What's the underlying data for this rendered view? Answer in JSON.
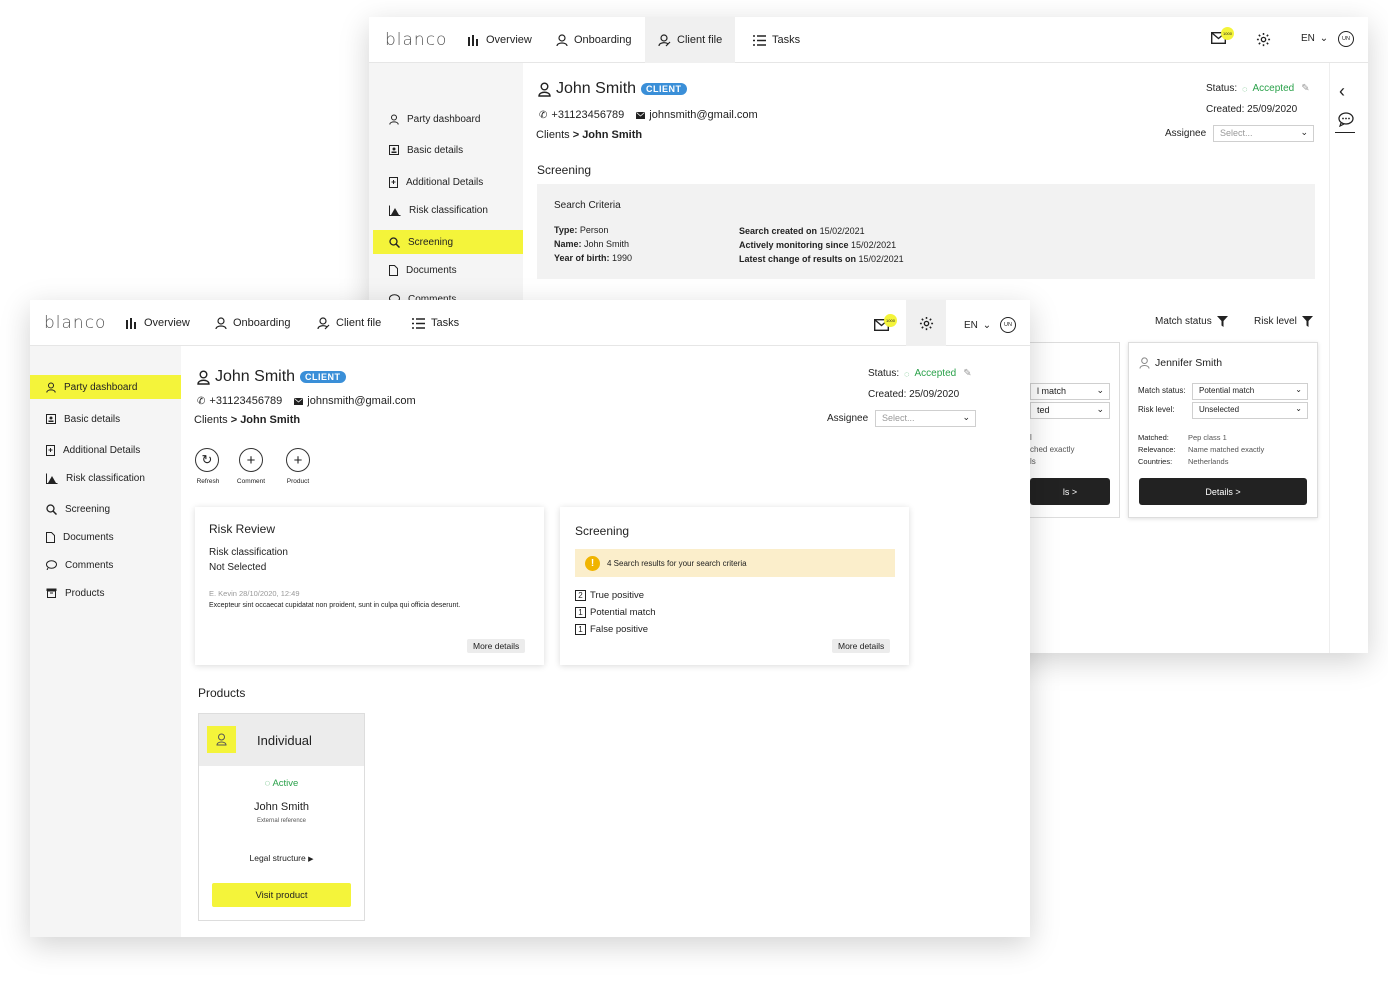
{
  "logo": "blanco",
  "nav": {
    "overview": "Overview",
    "onboarding": "Onboarding",
    "client_file": "Client file",
    "tasks": "Tasks",
    "mail_badge": "1000",
    "language": "EN",
    "avatar": "UN"
  },
  "sidebar": {
    "party_dashboard": "Party dashboard",
    "basic_details": "Basic details",
    "additional_details": "Additional Details",
    "risk_classification": "Risk classification",
    "screening": "Screening",
    "documents": "Documents",
    "comments": "Comments",
    "products": "Products"
  },
  "client": {
    "name": "John Smith",
    "tag": "CLIENT",
    "phone": "+31123456789",
    "email": "johnsmith@gmail.com",
    "breadcrumb_root": "Clients",
    "breadcrumb_sep": ">",
    "breadcrumb_current": "John Smith",
    "status_label": "Status:",
    "status_value": "Accepted",
    "created": "Created: 25/09/2020",
    "assignee_label": "Assignee",
    "assignee_placeholder": "Select..."
  },
  "back": {
    "section_title": "Screening",
    "criteria_title": "Search Criteria",
    "type_label": "Type:",
    "type_value": "Person",
    "name_label": "Name:",
    "name_value": "John Smith",
    "yob_label": "Year of birth:",
    "yob_value": "1990",
    "created_label": "Search created on",
    "created_value": "15/02/2021",
    "monitoring_label": "Actively monitoring since",
    "monitoring_value": "15/02/2021",
    "latest_label": "Latest change of results on",
    "latest_value": "15/02/2021",
    "match_status_filter": "Match status",
    "risk_level_filter": "Risk level",
    "partial_card": {
      "sel1": "l match",
      "sel2": "ted",
      "line1": "l",
      "line2": "ched exactly",
      "line3": "ls",
      "button": "ls >"
    },
    "result_card": {
      "name": "Jennifer Smith",
      "match_status_label": "Match status:",
      "match_status_value": "Potential match",
      "risk_level_label": "Risk level:",
      "risk_level_value": "Unselected",
      "matched_label": "Matched:",
      "matched_value": "Pep class 1",
      "relevance_label": "Relevance:",
      "relevance_value": "Name matched exactly",
      "countries_label": "Countries:",
      "countries_value": "Netherlands",
      "button": "Details >"
    }
  },
  "front": {
    "actions": {
      "refresh": "Refresh",
      "comment": "Comment",
      "product": "Product"
    },
    "risk_review": {
      "title": "Risk Review",
      "subtitle": "Risk classification",
      "value": "Not Selected",
      "meta": "E. Kevin 28/10/2020, 12:49",
      "note": "Excepteur sint occaecat cupidatat non proident, sunt in culpa qui officia deserunt.",
      "button": "More details"
    },
    "screening": {
      "title": "Screening",
      "alert": "4 Search results for your search criteria",
      "rows": [
        {
          "count": "2",
          "label": "True positive"
        },
        {
          "count": "1",
          "label": "Potential match"
        },
        {
          "count": "1",
          "label": "False positive"
        }
      ],
      "button": "More details"
    },
    "products": {
      "title": "Products",
      "card_title": "Individual",
      "status": "Active",
      "holder": "John Smith",
      "reference": "External reference",
      "legal": "Legal structure",
      "button": "Visit product"
    }
  }
}
